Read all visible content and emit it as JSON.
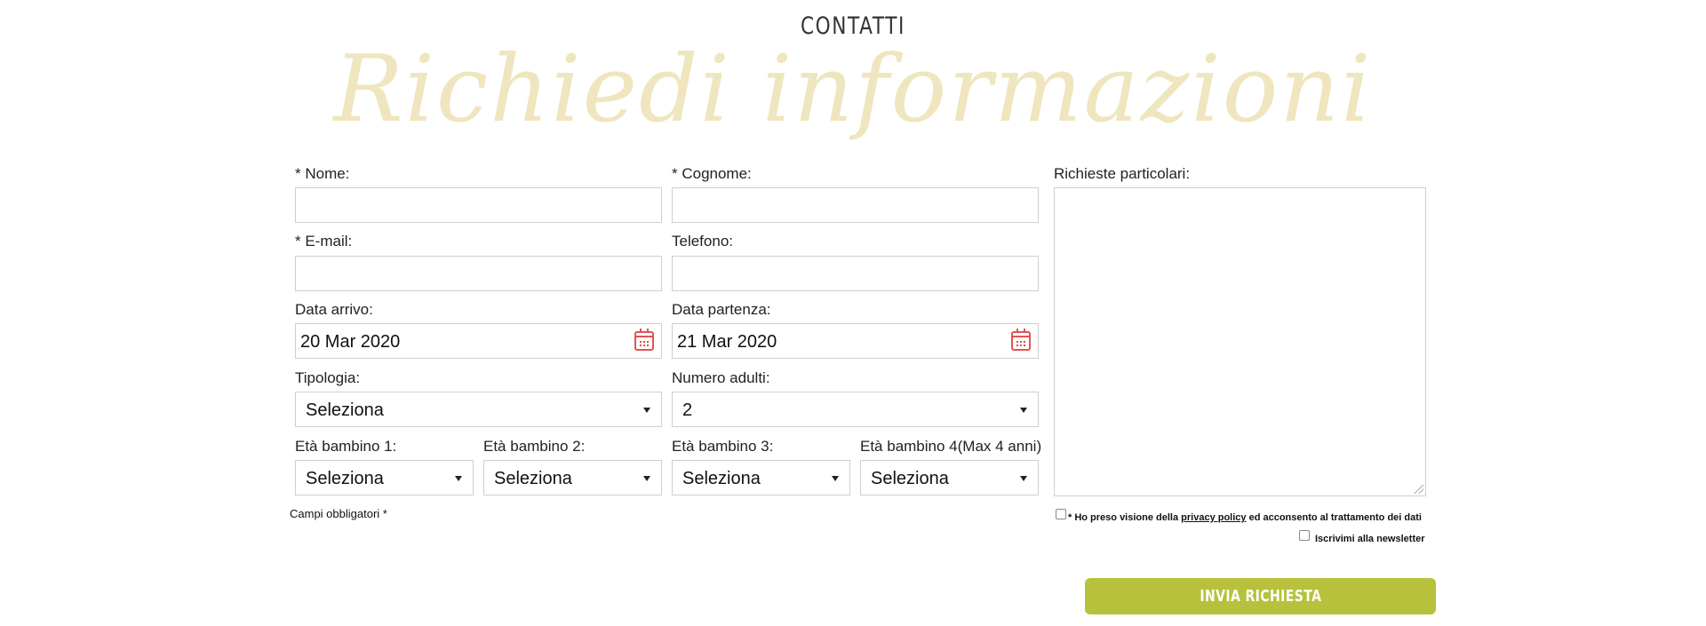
{
  "header": {
    "eyebrow": "CONTATTI",
    "title": "Richiedi informazioni"
  },
  "form": {
    "nome": {
      "label": "* Nome:",
      "value": ""
    },
    "cognome": {
      "label": "* Cognome:",
      "value": ""
    },
    "email": {
      "label": "* E-mail:",
      "value": ""
    },
    "telefono": {
      "label": "Telefono:",
      "value": ""
    },
    "data_arrivo": {
      "label": "Data arrivo:",
      "value": "20 Mar 2020",
      "icon": "calendar-icon"
    },
    "data_partenza": {
      "label": "Data partenza:",
      "value": "21 Mar 2020",
      "icon": "calendar-icon"
    },
    "tipologia": {
      "label": "Tipologia:",
      "value": "Seleziona"
    },
    "numero_adulti": {
      "label": "Numero adulti:",
      "value": "2"
    },
    "bambino1": {
      "label": "Età bambino 1:",
      "value": "Seleziona"
    },
    "bambino2": {
      "label": "Età bambino 2:",
      "value": "Seleziona"
    },
    "bambino3": {
      "label": "Età bambino 3:",
      "value": "Seleziona"
    },
    "bambino4": {
      "label": "Età bambino 4(Max 4 anni)",
      "value": "Seleziona"
    },
    "richieste": {
      "label": "Richieste particolari:",
      "value": ""
    },
    "required_note": "Campi obbligatori *",
    "privacy": {
      "prefix": "* Ho preso visione della ",
      "link": "privacy policy",
      "suffix": " ed acconsento al trattamento dei dati",
      "checked": false
    },
    "newsletter": {
      "label": "Iscrivimi alla newsletter",
      "checked": false
    },
    "submit_label": "INVIA RICHIESTA"
  },
  "colors": {
    "accent": "#b7c13b",
    "title_script": "#efe6bf",
    "calendar_icon": "#e05454",
    "border": "#cfcfcf"
  }
}
